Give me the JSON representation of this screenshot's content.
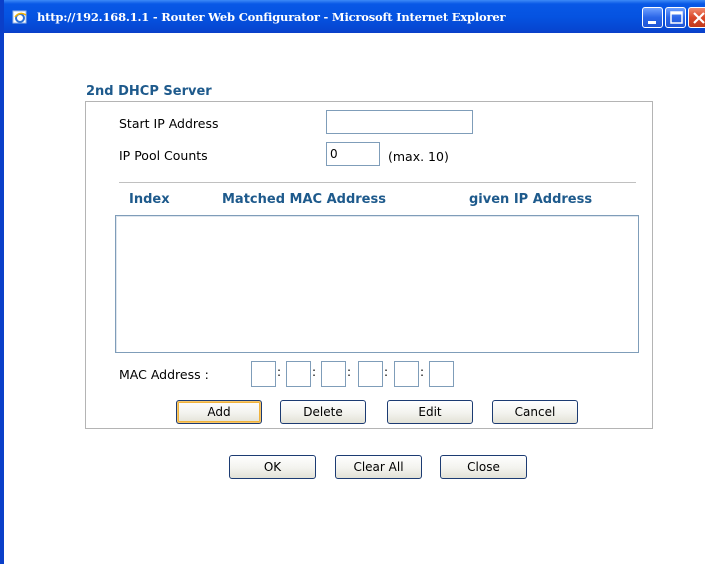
{
  "window": {
    "title": "http://192.168.1.1 - Router Web Configurator - Microsoft Internet Explorer",
    "icon": "ie-icon",
    "controls": [
      "minimize-icon",
      "maximize-icon",
      "close-icon"
    ]
  },
  "form": {
    "section_title": "2nd DHCP Server",
    "start_ip": {
      "label": "Start IP Address",
      "value": ""
    },
    "pool_counts": {
      "label": "IP Pool Counts",
      "value": "0",
      "note": "(max. 10)"
    },
    "table": {
      "columns": [
        "Index",
        "Matched MAC Address",
        "given IP Address"
      ],
      "rows": []
    },
    "mac": {
      "label": "MAC Address :",
      "octets": [
        "",
        "",
        "",
        "",
        "",
        ""
      ],
      "separator": ":"
    },
    "list_buttons": {
      "add": "Add",
      "delete": "Delete",
      "edit": "Edit",
      "cancel": "Cancel"
    }
  },
  "footer_buttons": {
    "ok": "OK",
    "clear_all": "Clear All",
    "close": "Close"
  },
  "colors": {
    "titlebar": "#0553e1",
    "section_heading": "#1e5a8c",
    "panel_border": "#b4b4b4"
  }
}
